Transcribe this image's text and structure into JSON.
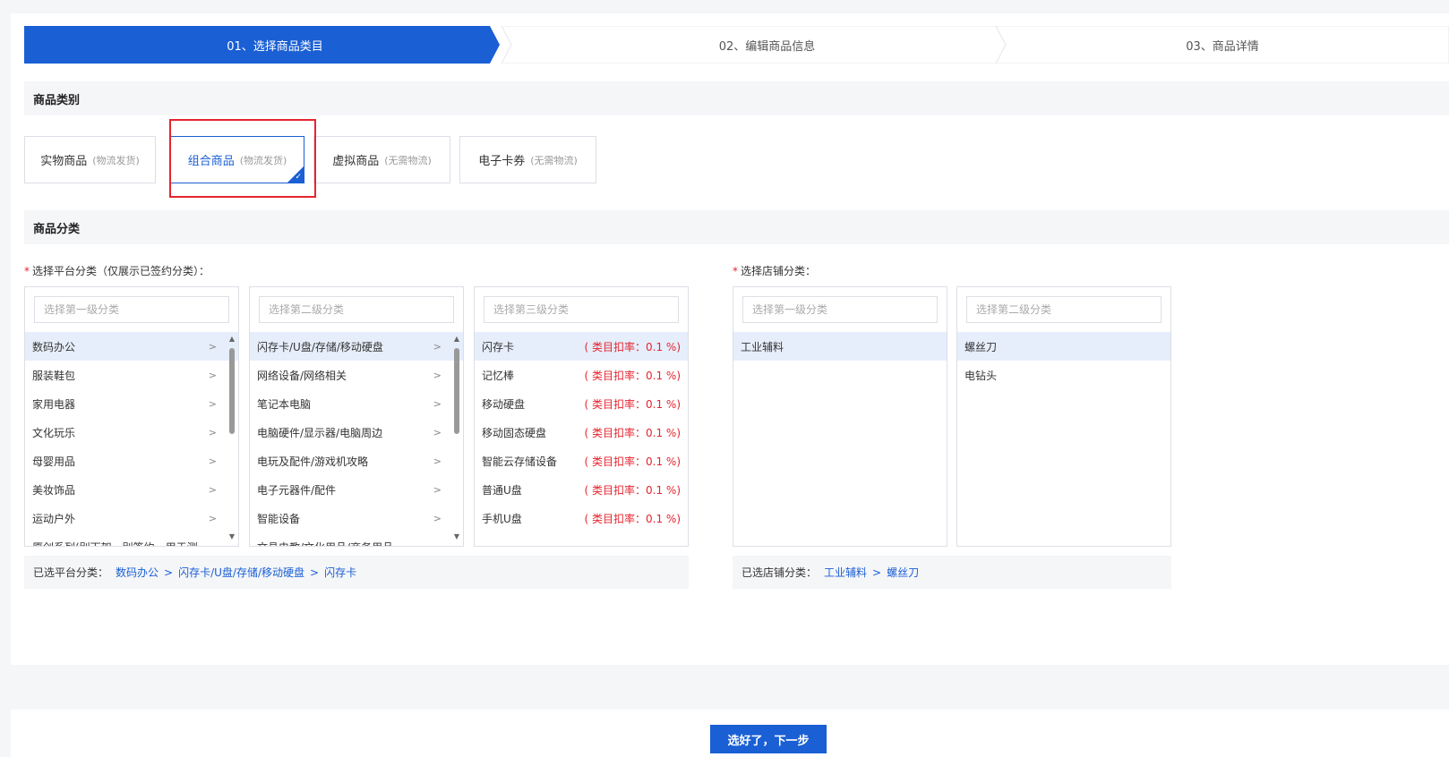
{
  "steps": [
    {
      "label": "01、选择商品类目"
    },
    {
      "label": "02、编辑商品信息"
    },
    {
      "label": "03、商品详情"
    }
  ],
  "colors": {
    "accent": "#1a5fd4",
    "danger": "#e5252f"
  },
  "type_section": {
    "title": "商品类别",
    "types": [
      {
        "label": "实物商品",
        "sub": "(物流发货)"
      },
      {
        "label": "组合商品",
        "sub": "(物流发货)"
      },
      {
        "label": "虚拟商品",
        "sub": "(无需物流)"
      },
      {
        "label": "电子卡券",
        "sub": "(无需物流)"
      }
    ]
  },
  "category_section": {
    "title": "商品分类",
    "platform_label": "选择平台分类（仅展示已签约分类）：",
    "store_label": "选择店铺分类：",
    "level1": {
      "placeholder": "选择第一级分类",
      "items": [
        "数码办公",
        "服装鞋包",
        "家用电器",
        "文化玩乐",
        "母婴用品",
        "美妆饰品",
        "运动户外",
        "原创系列(别下架，别签约，用于测"
      ]
    },
    "level2": {
      "placeholder": "选择第二级分类",
      "items": [
        "闪存卡/U盘/存储/移动硬盘",
        "网络设备/网络相关",
        "笔记本电脑",
        "电脑硬件/显示器/电脑周边",
        "电玩及配件/游戏机攻略",
        "电子元器件/配件",
        "智能设备",
        "文具电教/文化用品/商务用品"
      ]
    },
    "level3": {
      "placeholder": "选择第三级分类",
      "items": [
        {
          "label": "闪存卡",
          "rate": "( 类目扣率：0.1 %)"
        },
        {
          "label": "记忆棒",
          "rate": "( 类目扣率：0.1 %)"
        },
        {
          "label": "移动硬盘",
          "rate": "( 类目扣率：0.1 %)"
        },
        {
          "label": "移动固态硬盘",
          "rate": "( 类目扣率：0.1 %)"
        },
        {
          "label": "智能云存储设备",
          "rate": "( 类目扣率：0.1 %)"
        },
        {
          "label": "普通U盘",
          "rate": "( 类目扣率：0.1 %)"
        },
        {
          "label": "手机U盘",
          "rate": "( 类目扣率：0.1 %)"
        }
      ]
    },
    "store1": {
      "placeholder": "选择第一级分类",
      "items": [
        "工业辅料"
      ]
    },
    "store2": {
      "placeholder": "选择第二级分类",
      "items": [
        "螺丝刀",
        "电钻头"
      ]
    },
    "platform_path": {
      "label": "已选平台分类：",
      "parts": [
        "数码办公",
        "闪存卡/U盘/存储/移动硬盘",
        "闪存卡"
      ]
    },
    "store_path": {
      "label": "已选店铺分类：",
      "parts": [
        "工业辅料",
        "螺丝刀"
      ]
    },
    "sep": ">"
  },
  "next_button": "选好了，下一步"
}
